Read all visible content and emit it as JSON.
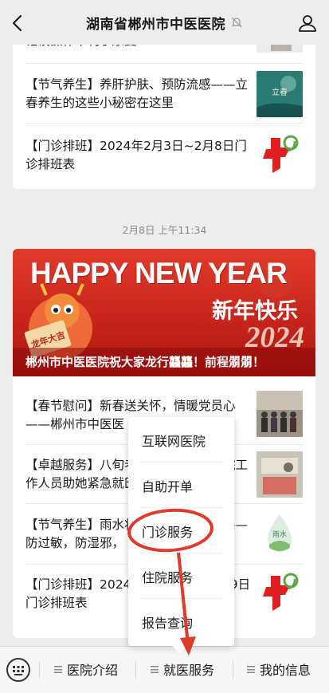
{
  "header": {
    "title": "湖南省郴州市中医医院"
  },
  "card1": {
    "top_partial": "错误操作不利于康复",
    "items": [
      {
        "text": "【节气养生】养肝护肤、预防流感——立春养生的这些小秘密在这里",
        "thumb_text": "立春"
      },
      {
        "text": "【门诊排班】2024年2月3日~2月8日门诊排班表"
      }
    ]
  },
  "timestamp": "2月8日 上午11:34",
  "card2": {
    "banner": {
      "headline": "HAPPY NEW YEAR",
      "sub": "新年快乐",
      "year": "2024",
      "badge": "龙年大吉",
      "caption": "郴州市中医医院祝大家龙行龘龘！前程朤朤！"
    },
    "items": [
      {
        "text": "【春节慰问】新春送关怀，情暖党员心——郴州市中医医"
      },
      {
        "text": "【卓越服务】八旬老人突发疾病，我院工作人员助她紧急就医"
      },
      {
        "text": "【节气养生】雨水将至，做好这几点——防过敏，防湿邪，",
        "thumb_text": "雨水"
      },
      {
        "text": "【门诊排班】2024年2月24日~2月29日门诊排班表"
      }
    ]
  },
  "popup_menu": {
    "items": [
      "互联网医院",
      "自助开单",
      "门诊服务",
      "住院服务",
      "报告查询"
    ],
    "highlighted": "门诊服务"
  },
  "bottom_bar": {
    "tabs": [
      "医院介绍",
      "就医服务",
      "我的信息"
    ]
  },
  "colors": {
    "annotation_red": "#e03a2a",
    "brand_red": "#e02020",
    "brand_green": "#5aa845"
  }
}
